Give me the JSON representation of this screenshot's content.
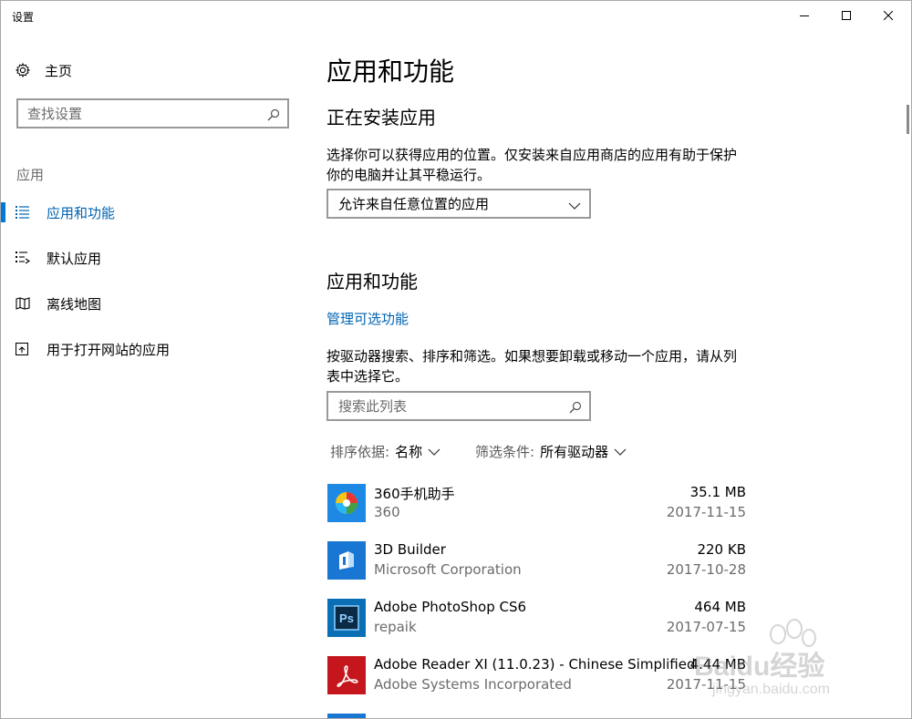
{
  "window": {
    "title": "设置"
  },
  "nav": {
    "home_label": "主页",
    "search_placeholder": "查找设置",
    "section_label": "应用",
    "items": [
      {
        "label": "应用和功能",
        "icon": "list-icon",
        "active": true
      },
      {
        "label": "默认应用",
        "icon": "default-apps-icon",
        "active": false
      },
      {
        "label": "离线地图",
        "icon": "map-icon",
        "active": false
      },
      {
        "label": "用于打开网站的应用",
        "icon": "open-app-icon",
        "active": false
      }
    ]
  },
  "main": {
    "page_title": "应用和功能",
    "install_section": {
      "title": "正在安装应用",
      "description": "选择你可以获得应用的位置。仅安装来自应用商店的应用有助于保护你的电脑并让其平稳运行。",
      "dropdown_value": "允许来自任意位置的应用"
    },
    "apps_section": {
      "title": "应用和功能",
      "manage_link": "管理可选功能",
      "description": "按驱动器搜索、排序和筛选。如果想要卸载或移动一个应用，请从列表中选择它。",
      "search_placeholder": "搜索此列表",
      "sort_label": "排序依据:",
      "sort_value": "名称",
      "filter_label": "筛选条件:",
      "filter_value": "所有驱动器"
    },
    "apps": [
      {
        "name": "360手机助手",
        "publisher": "360",
        "size": "35.1 MB",
        "date": "2017-11-15",
        "icon": "360-assistant-icon",
        "icon_bg": "#1e88e5"
      },
      {
        "name": "3D Builder",
        "publisher": "Microsoft Corporation",
        "size": "220 KB",
        "date": "2017-10-28",
        "icon": "3d-builder-icon",
        "icon_bg": "#1976d2"
      },
      {
        "name": "Adobe PhotoShop CS6",
        "publisher": "repaik",
        "size": "464 MB",
        "date": "2017-07-15",
        "icon": "photoshop-icon",
        "icon_bg": "#0b6fb5"
      },
      {
        "name": "Adobe Reader XI (11.0.23) - Chinese Simplified",
        "publisher": "Adobe Systems Incorporated",
        "size": "4.44 MB",
        "date": "2017-11-15",
        "icon": "adobe-reader-icon",
        "icon_bg": "#c4161c"
      }
    ]
  },
  "watermark": {
    "text": "Baidu经验",
    "subtext": "jingyan.baidu.com"
  }
}
